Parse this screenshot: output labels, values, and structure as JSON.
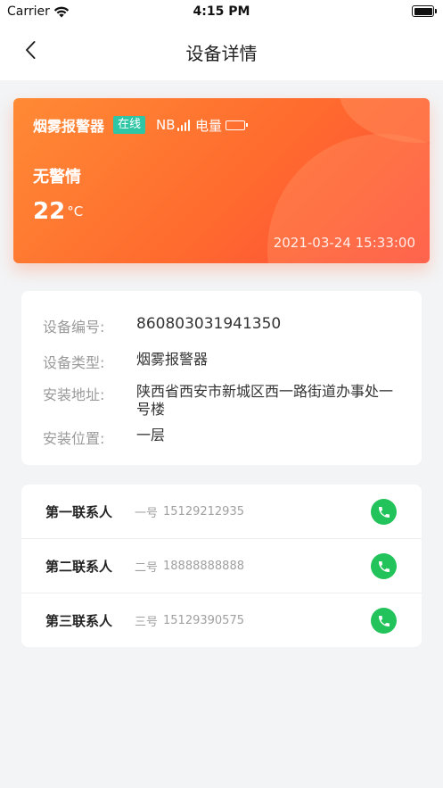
{
  "status_bar": {
    "carrier": "Carrier",
    "time": "4:15 PM"
  },
  "nav": {
    "title": "设备详情"
  },
  "device": {
    "name": "烟雾报警器",
    "online_status": "在线",
    "network": "NB",
    "battery_label": "电量",
    "alarm_status": "无警情",
    "temperature_value": "22",
    "temperature_unit": "°C",
    "timestamp": "2021-03-24 15:33:00"
  },
  "info": {
    "items": [
      {
        "label": "设备编号:",
        "value": "860803031941350"
      },
      {
        "label": "设备类型:",
        "value": "烟雾报警器"
      },
      {
        "label": "安装地址:",
        "value": "陕西省西安市新城区西一路街道办事处一号楼"
      },
      {
        "label": "安装位置:",
        "value": "一层"
      }
    ]
  },
  "contacts": {
    "items": [
      {
        "title": "第一联系人",
        "name": "一号",
        "phone": "15129212935"
      },
      {
        "title": "第二联系人",
        "name": "二号",
        "phone": "18888888888"
      },
      {
        "title": "第三联系人",
        "name": "三号",
        "phone": "15129390575"
      }
    ]
  },
  "colors": {
    "card_gradient_start": "#ff8a35",
    "card_gradient_end": "#ff4a3d",
    "online_badge": "#2fc6a5",
    "call_button": "#22c35a"
  }
}
